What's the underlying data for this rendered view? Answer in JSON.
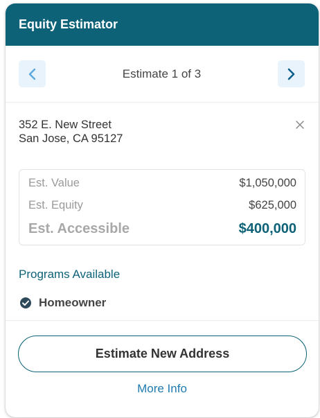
{
  "header": {
    "title": "Equity Estimator"
  },
  "nav": {
    "label": "Estimate 1 of 3",
    "prev_icon": "chevron-left-icon",
    "next_icon": "chevron-right-icon"
  },
  "address": {
    "line1": "352 E. New Street",
    "line2": "San Jose, CA 95127"
  },
  "estimates": [
    {
      "label": "Est. Value",
      "value": "$1,050,000"
    },
    {
      "label": "Est. Equity",
      "value": "$625,000"
    },
    {
      "label": "Est. Accessible",
      "value": "$400,000"
    }
  ],
  "programs": {
    "title": "Programs Available",
    "items": [
      {
        "label": "Homeowner",
        "icon": "check-circle-icon"
      }
    ]
  },
  "actions": {
    "primary_label": "Estimate New Address",
    "link_label": "More Info"
  },
  "colors": {
    "brand": "#0d6277",
    "link": "#1f7ab0",
    "nav_button_bg": "#e8f3fb"
  }
}
